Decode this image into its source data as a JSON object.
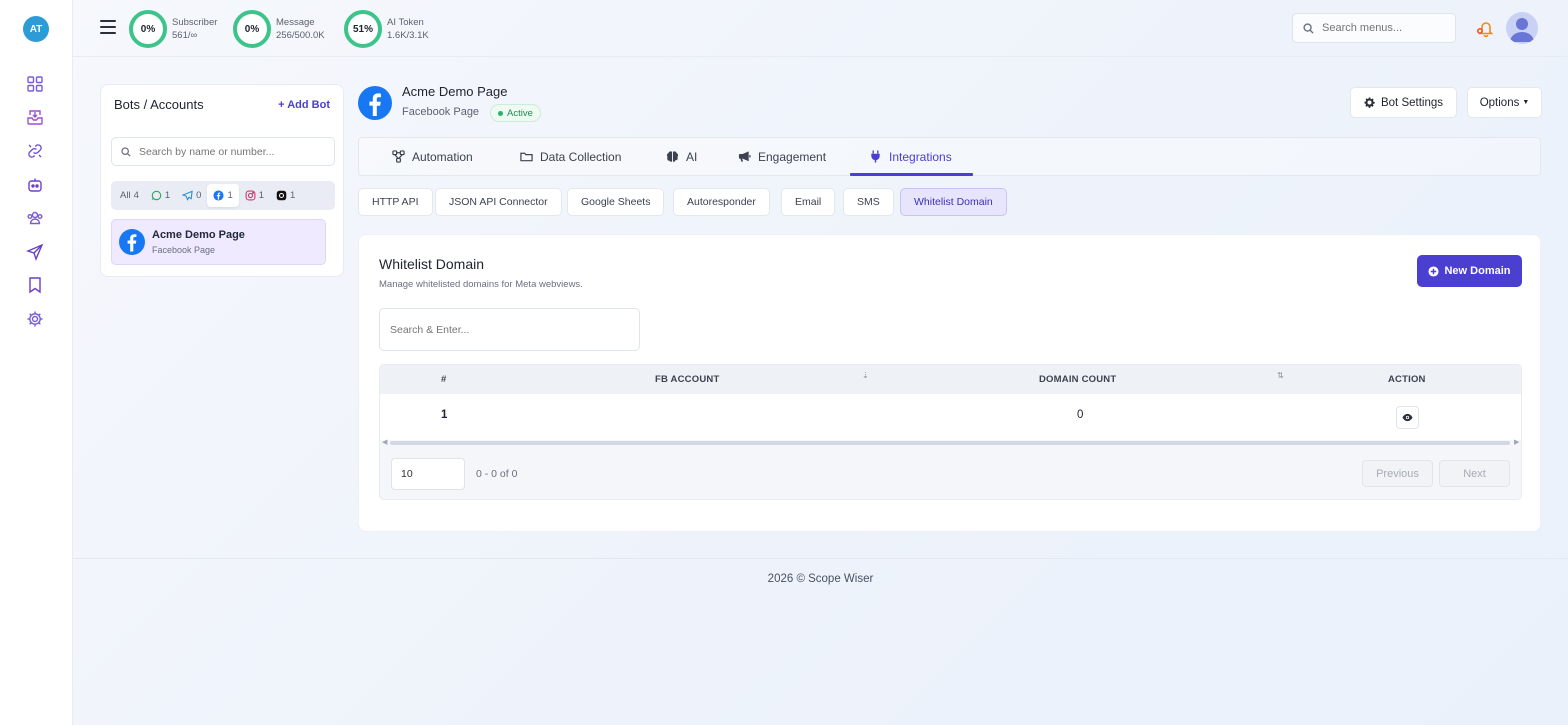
{
  "app": {
    "avatar_initials": "AT",
    "accent": "#4a3fd0",
    "ring_color": "#3cc48a"
  },
  "rail": {
    "items": [
      {
        "name": "dashboard-icon"
      },
      {
        "name": "inbox-icon"
      },
      {
        "name": "link-icon"
      },
      {
        "name": "bot-icon"
      },
      {
        "name": "users-icon"
      },
      {
        "name": "send-icon"
      },
      {
        "name": "bookmark-icon"
      },
      {
        "name": "gear-icon"
      }
    ]
  },
  "topbar": {
    "stats": [
      {
        "percent": "0%",
        "label": "Subscriber",
        "value": "561/∞"
      },
      {
        "percent": "0%",
        "label": "Message",
        "value": "256/500.0K"
      },
      {
        "percent": "51%",
        "label": "AI Token",
        "value": "1.6K/3.1K"
      }
    ],
    "search_placeholder": "Search menus..."
  },
  "bots_panel": {
    "title": "Bots / Accounts",
    "add_label": "Add Bot",
    "search_placeholder": "Search by name or number...",
    "filters": [
      {
        "label": "All",
        "count": "4"
      },
      {
        "icon": "whatsapp-icon",
        "count": "1"
      },
      {
        "icon": "telegram-icon",
        "count": "0"
      },
      {
        "icon": "facebook-icon",
        "count": "1"
      },
      {
        "icon": "instagram-icon",
        "count": "1"
      },
      {
        "icon": "threads-icon",
        "count": "1"
      }
    ],
    "bot": {
      "name": "Acme Demo Page",
      "type": "Facebook Page"
    }
  },
  "page_header": {
    "name": "Acme Demo Page",
    "type": "Facebook Page",
    "status": "Active",
    "bot_settings_label": "Bot Settings",
    "options_label": "Options"
  },
  "tabs": [
    {
      "label": "Automation"
    },
    {
      "label": "Data Collection"
    },
    {
      "label": "AI"
    },
    {
      "label": "Engagement"
    },
    {
      "label": "Integrations"
    }
  ],
  "subtabs": [
    {
      "label": "HTTP API"
    },
    {
      "label": "JSON API Connector"
    },
    {
      "label": "Google Sheets"
    },
    {
      "label": "Autoresponder"
    },
    {
      "label": "Email"
    },
    {
      "label": "SMS"
    },
    {
      "label": "Whitelist Domain"
    }
  ],
  "whitelist": {
    "title": "Whitelist Domain",
    "description": "Manage whitelisted domains for Meta webviews.",
    "new_button_label": "New Domain",
    "search_placeholder": "Search & Enter...",
    "columns": [
      "#",
      "FB ACCOUNT",
      "DOMAIN COUNT",
      "ACTION"
    ],
    "rows": [
      {
        "index": "1",
        "fb_account": "",
        "domain_count": "0"
      }
    ],
    "per_page": "10",
    "range": "0 - 0 of 0",
    "prev_label": "Previous",
    "next_label": "Next"
  },
  "footer": {
    "text": "2026 © Scope Wiser"
  }
}
